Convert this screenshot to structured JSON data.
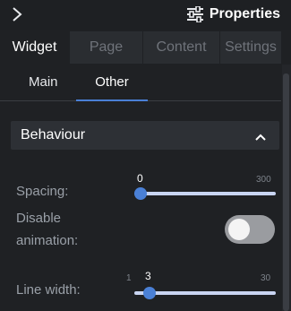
{
  "header": {
    "title": "Properties",
    "collapse_icon": "chevron-right-icon",
    "title_icon": "sliders-icon"
  },
  "tabs": [
    {
      "label": "Widget",
      "active": true
    },
    {
      "label": "Page",
      "active": false
    },
    {
      "label": "Content",
      "active": false
    },
    {
      "label": "Settings",
      "active": false
    }
  ],
  "subtabs": [
    {
      "label": "Main",
      "active": false
    },
    {
      "label": "Other",
      "active": true
    }
  ],
  "section": {
    "title": "Behaviour",
    "expanded": true,
    "chevron_icon": "chevron-up-icon"
  },
  "fields": {
    "spacing": {
      "label": "Spacing:",
      "value": "0",
      "min": "0",
      "max": "300",
      "fraction": 0
    },
    "disable_animation": {
      "label_line1": "Disable",
      "label_line2": "animation:",
      "checked": false
    },
    "line_width": {
      "label": "Line width:",
      "value": "3",
      "min": "1",
      "max": "30",
      "fraction": 0.069
    }
  },
  "colors": {
    "accent": "#4a80d6",
    "background": "#1f2124",
    "section_bg": "#2d3035",
    "track": "#c9d5f2"
  }
}
